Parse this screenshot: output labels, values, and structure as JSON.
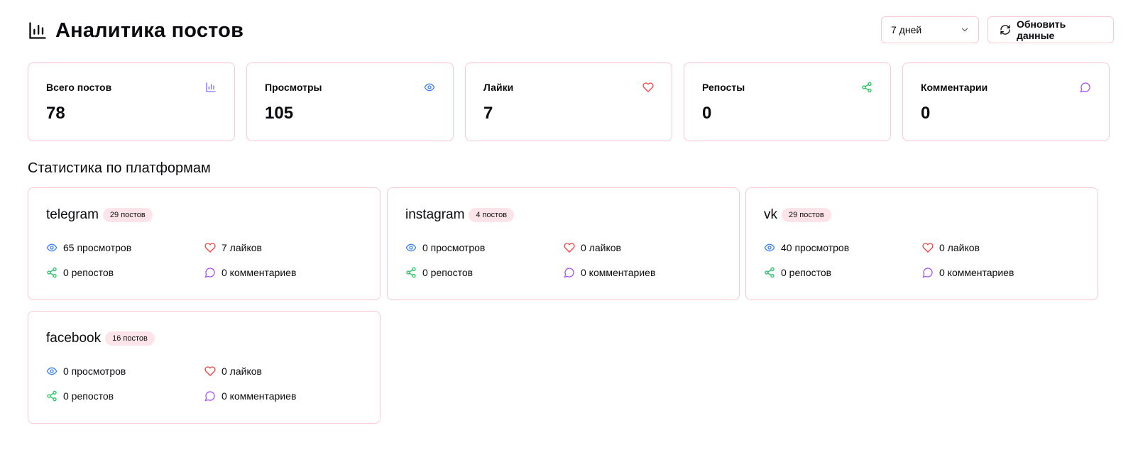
{
  "header": {
    "title": "Аналитика постов",
    "period": {
      "value": "7 дней"
    },
    "refresh_label": "Обновить данные"
  },
  "stats": [
    {
      "label": "Всего постов",
      "value": "78",
      "icon": "bar-chart-icon",
      "color": "#7c6ff2"
    },
    {
      "label": "Просмотры",
      "value": "105",
      "icon": "eye-icon",
      "color": "#3b82f6"
    },
    {
      "label": "Лайки",
      "value": "7",
      "icon": "heart-icon",
      "color": "#ef4444"
    },
    {
      "label": "Репосты",
      "value": "0",
      "icon": "share-icon",
      "color": "#22c55e"
    },
    {
      "label": "Комментарии",
      "value": "0",
      "icon": "message-icon",
      "color": "#a855f7"
    }
  ],
  "section_title": "Статистика по платформам",
  "platforms": [
    {
      "name": "telegram",
      "badge": "29 постов",
      "views": "65 просмотров",
      "likes": "7 лайков",
      "reposts": "0 репостов",
      "comments": "0 комментариев"
    },
    {
      "name": "instagram",
      "badge": "4 постов",
      "views": "0 просмотров",
      "likes": "0 лайков",
      "reposts": "0 репостов",
      "comments": "0 комментариев"
    },
    {
      "name": "vk",
      "badge": "29 постов",
      "views": "40 просмотров",
      "likes": "0 лайков",
      "reposts": "0 репостов",
      "comments": "0 комментариев"
    },
    {
      "name": "facebook",
      "badge": "16 постов",
      "views": "0 просмотров",
      "likes": "0 лайков",
      "reposts": "0 репостов",
      "comments": "0 комментариев"
    }
  ],
  "colors": {
    "border": "#f8c9d3",
    "badge_bg": "#fde4ea",
    "views": "#3b82f6",
    "likes": "#ef4444",
    "reposts": "#22c55e",
    "comments": "#a855f7"
  }
}
